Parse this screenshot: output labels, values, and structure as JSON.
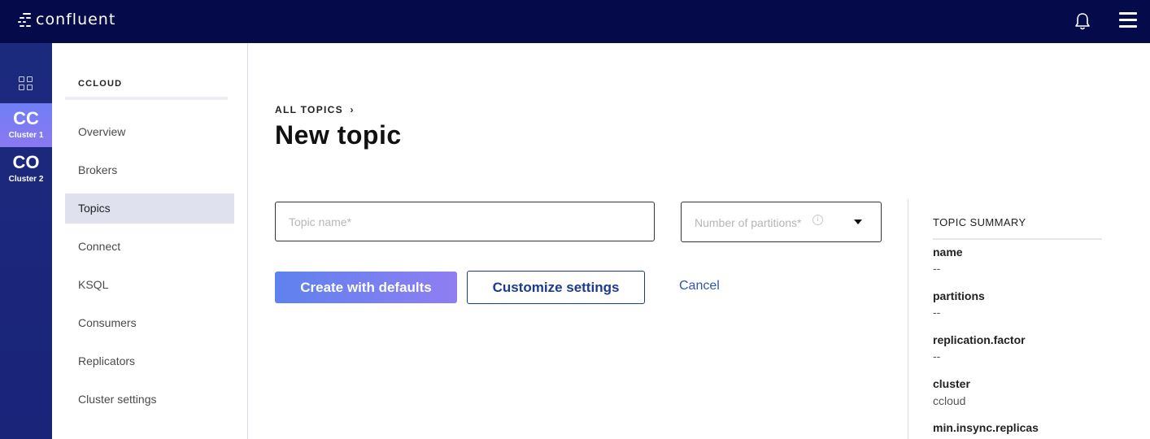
{
  "app": {
    "logo_text": "confluent"
  },
  "topbar": {
    "icons": [
      "bell-icon",
      "hamburger-menu-icon"
    ]
  },
  "rail": {
    "home_icon": "grid-icon",
    "clusters": [
      {
        "abbr": "CC",
        "name": "Cluster 1",
        "active": true
      },
      {
        "abbr": "CO",
        "name": "Cluster 2",
        "active": false
      }
    ]
  },
  "sidebar": {
    "title": "CCLOUD",
    "items": [
      {
        "label": "Overview"
      },
      {
        "label": "Brokers"
      },
      {
        "label": "Topics",
        "active": true
      },
      {
        "label": "Connect"
      },
      {
        "label": "KSQL"
      },
      {
        "label": "Consumers"
      },
      {
        "label": "Replicators"
      },
      {
        "label": "Cluster settings"
      }
    ]
  },
  "main": {
    "breadcrumb": "ALL TOPICS",
    "breadcrumb_chevron": "›",
    "title": "New topic",
    "topic_name_placeholder": "Topic name*",
    "partitions_placeholder": "Number of partitions*",
    "info_glyph": "i",
    "create_button": "Create with defaults",
    "customize_button": "Customize settings",
    "cancel_link": "Cancel"
  },
  "summary": {
    "title": "TOPIC SUMMARY",
    "fields": [
      {
        "key": "name",
        "value": "--"
      },
      {
        "key": "partitions",
        "value": "--"
      },
      {
        "key": "replication.factor",
        "value": "--"
      },
      {
        "key": "cluster",
        "value": "ccloud"
      },
      {
        "key": "min.insync.replicas",
        "value": ""
      }
    ]
  },
  "colors": {
    "topbar_bg": "#050a4a",
    "rail_bg": "#1c2a7e",
    "accent_gradient_start": "#5e82ee",
    "accent_gradient_end": "#8f7ef2",
    "outline_button": "#1d3a92",
    "link": "#2f56b3"
  }
}
